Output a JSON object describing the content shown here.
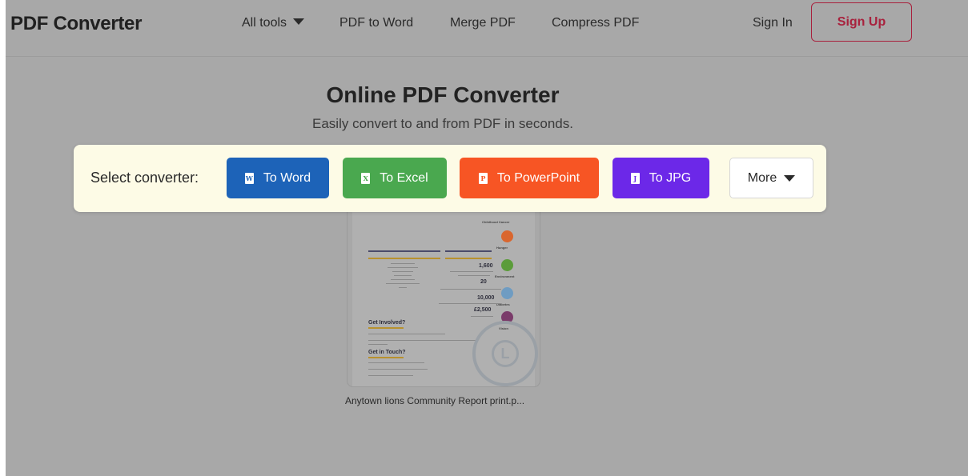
{
  "header": {
    "logo": "PDF Converter",
    "nav": {
      "all_tools": "All tools",
      "pdf_to_word": "PDF to Word",
      "merge_pdf": "Merge PDF",
      "compress_pdf": "Compress PDF"
    },
    "sign_in": "Sign In",
    "sign_up": "Sign Up"
  },
  "hero": {
    "title": "Online PDF Converter",
    "subtitle": "Easily convert to and from PDF in seconds."
  },
  "converter": {
    "label": "Select converter:",
    "buttons": [
      {
        "label": "To Word",
        "icon": "word-icon",
        "icon_letter": "W",
        "color": "#1d63b8"
      },
      {
        "label": "To Excel",
        "icon": "excel-icon",
        "icon_letter": "X",
        "color": "#4aa84f"
      },
      {
        "label": "To PowerPoint",
        "icon": "powerpoint-icon",
        "icon_letter": "P",
        "color": "#f75524"
      },
      {
        "label": "To JPG",
        "icon": "jpg-icon",
        "icon_letter": "J",
        "color": "#6c28e8"
      }
    ],
    "more": "More"
  },
  "file": {
    "name": "Anytown lions Community Report print.p...",
    "preview": {
      "numbers": [
        "1,600",
        "20",
        "10,000",
        "£2,500"
      ],
      "headings": [
        "Get Involved?",
        "Get in Touch?"
      ],
      "icon_labels": [
        "Childhood Cancer",
        "Hunger",
        "Environment",
        "Diabetes",
        "Vision"
      ]
    }
  }
}
